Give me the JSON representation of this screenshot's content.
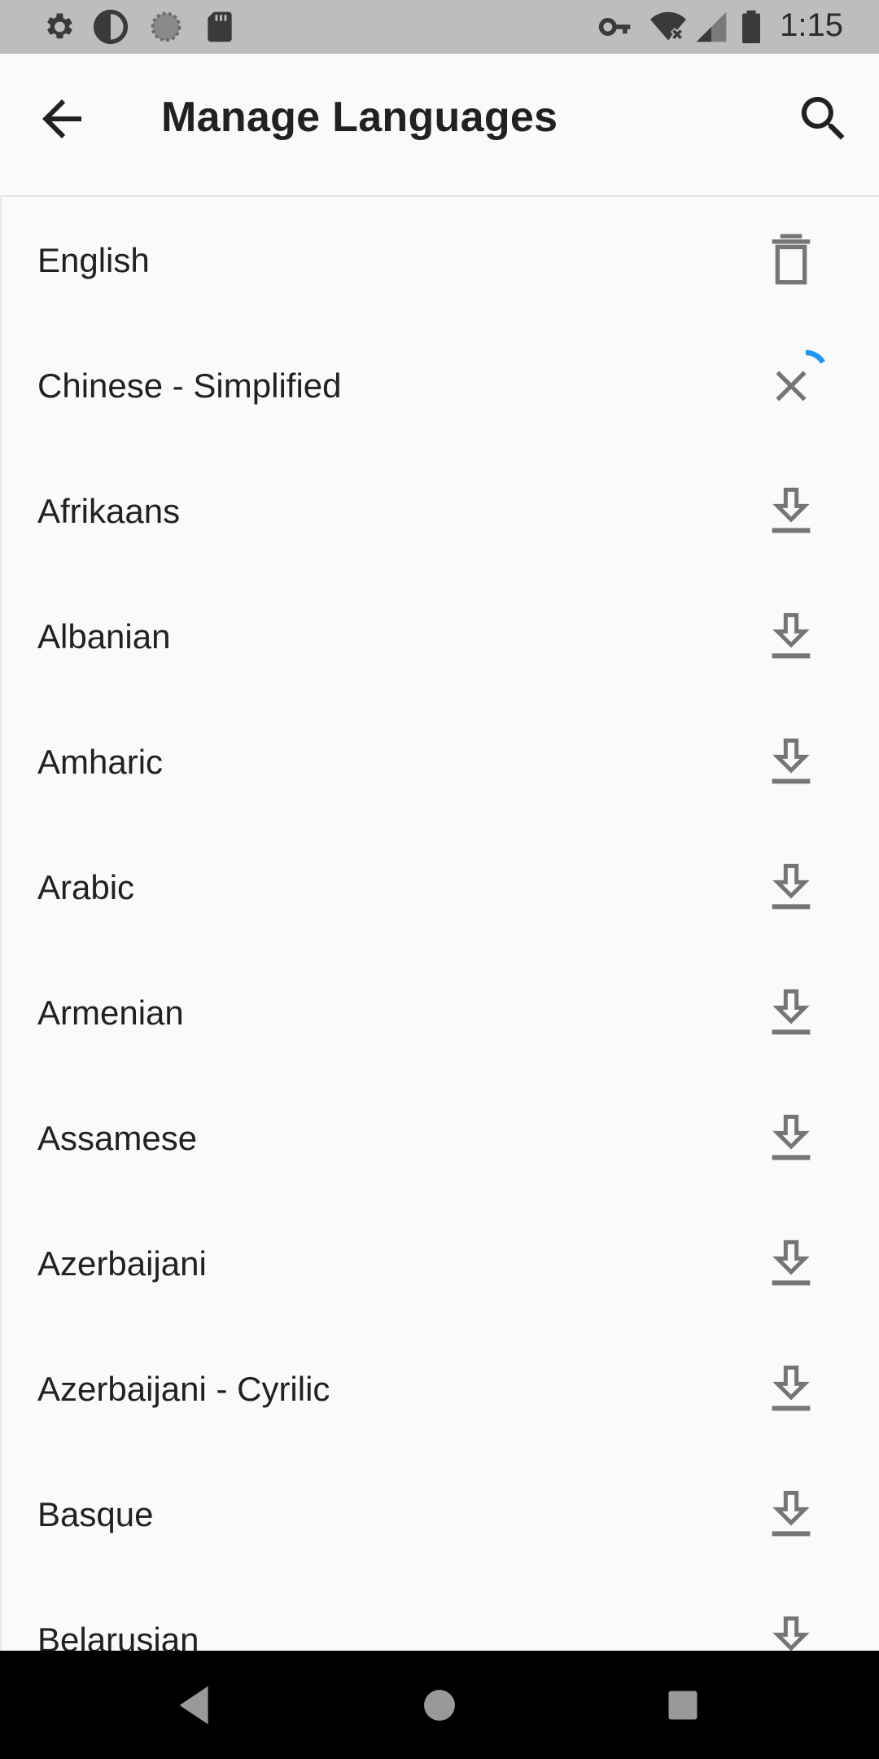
{
  "status_bar": {
    "time": "1:15",
    "left_icons": [
      "settings-icon",
      "brightness-icon",
      "sync-icon",
      "sd-card-icon"
    ],
    "right_icons": [
      "vpn-key-icon",
      "wifi-off-icon",
      "signal-icon",
      "battery-icon"
    ]
  },
  "app_bar": {
    "title": "Manage Languages",
    "back_icon": "arrow-back-icon",
    "search_icon": "search-icon"
  },
  "languages": [
    {
      "name": "English",
      "action": "delete"
    },
    {
      "name": "Chinese - Simplified",
      "action": "cancel-downloading"
    },
    {
      "name": "Afrikaans",
      "action": "download"
    },
    {
      "name": "Albanian",
      "action": "download"
    },
    {
      "name": "Amharic",
      "action": "download"
    },
    {
      "name": "Arabic",
      "action": "download"
    },
    {
      "name": "Armenian",
      "action": "download"
    },
    {
      "name": "Assamese",
      "action": "download"
    },
    {
      "name": "Azerbaijani",
      "action": "download"
    },
    {
      "name": "Azerbaijani - Cyrilic",
      "action": "download"
    },
    {
      "name": "Basque",
      "action": "download"
    },
    {
      "name": "Belarusian",
      "action": "download"
    }
  ],
  "colors": {
    "status_bar": "#bdbdbd",
    "background": "#fafafa",
    "icon_grey": "#757575",
    "progress_accent": "#2196f3",
    "nav_bar": "#000000"
  },
  "nav_bar": {
    "buttons": [
      "back-triangle-icon",
      "home-circle-icon",
      "recents-square-icon"
    ]
  }
}
